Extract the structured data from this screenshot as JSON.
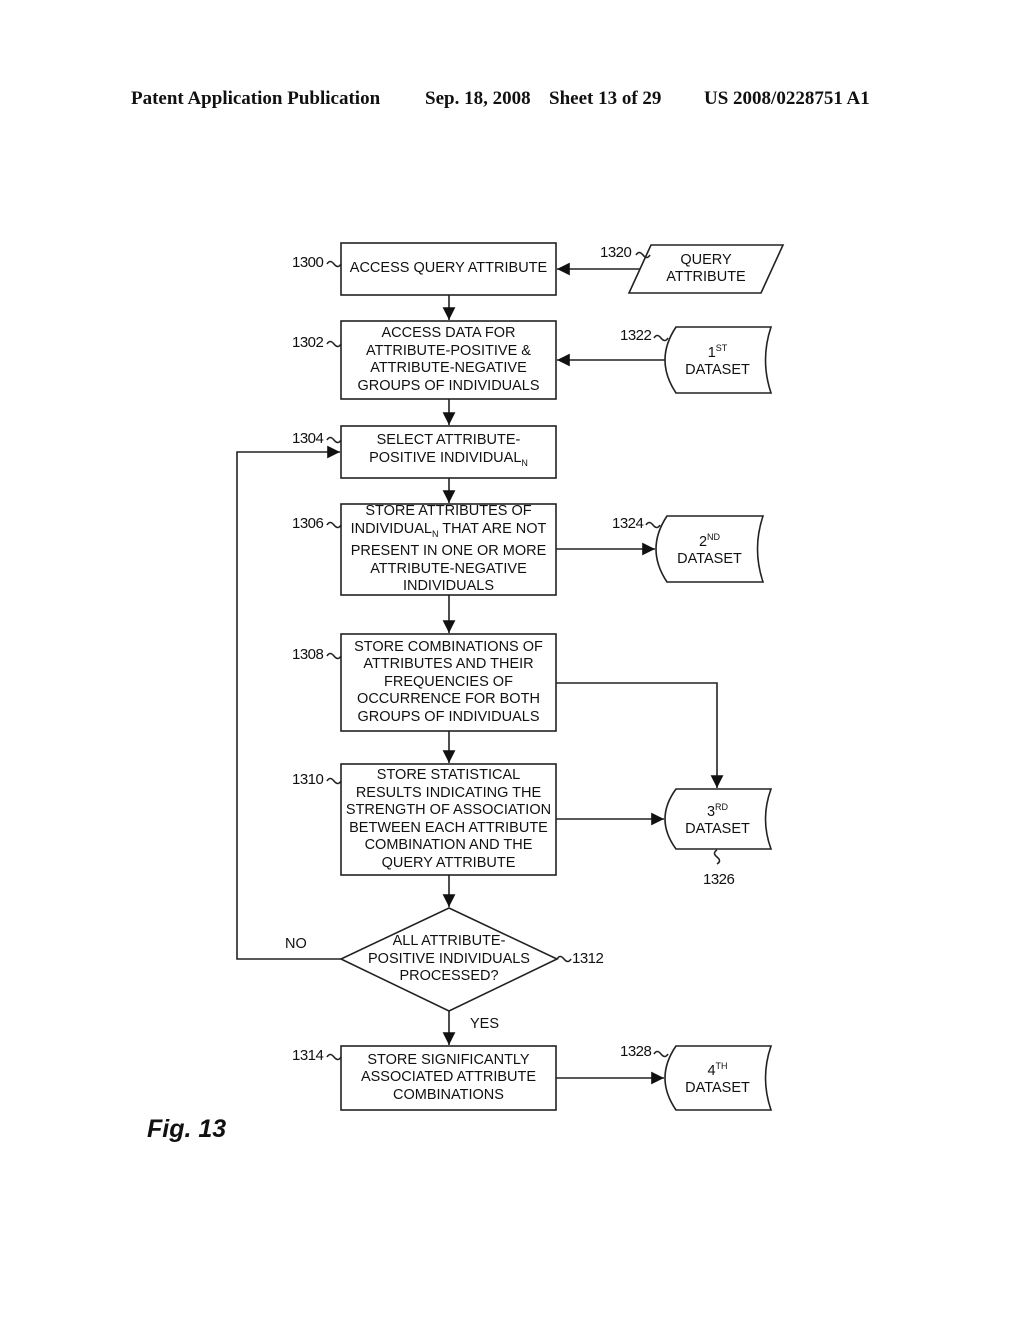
{
  "header": {
    "publication": "Patent Application Publication",
    "date": "Sep. 18, 2008",
    "sheet": "Sheet 13 of 29",
    "patent_number": "US 2008/0228751 A1"
  },
  "figure_label": "Fig. 13",
  "steps": {
    "s1300": {
      "ref": "1300",
      "text": "ACCESS QUERY ATTRIBUTE"
    },
    "s1302": {
      "ref": "1302",
      "line1": "ACCESS DATA FOR",
      "line2": "ATTRIBUTE-POSITIVE &",
      "line3": "ATTRIBUTE-NEGATIVE",
      "line4": "GROUPS OF INDIVIDUALS"
    },
    "s1304": {
      "ref": "1304",
      "line1": "SELECT ATTRIBUTE-",
      "line2": "POSITIVE INDIVIDUAL",
      "sub": "N"
    },
    "s1306": {
      "ref": "1306",
      "line1": "STORE ATTRIBUTES OF",
      "line2a": "INDIVIDUAL",
      "sub": "N",
      "line2b": " THAT ARE NOT",
      "line3": "PRESENT IN ONE OR MORE",
      "line4": "ATTRIBUTE-NEGATIVE",
      "line5": "INDIVIDUALS"
    },
    "s1308": {
      "ref": "1308",
      "line1": "STORE COMBINATIONS OF",
      "line2": "ATTRIBUTES AND THEIR",
      "line3": "FREQUENCIES OF",
      "line4": "OCCURRENCE FOR BOTH",
      "line5": "GROUPS OF INDIVIDUALS"
    },
    "s1310": {
      "ref": "1310",
      "line1": "STORE STATISTICAL",
      "line2": "RESULTS INDICATING THE",
      "line3": "STRENGTH OF ASSOCIATION",
      "line4": "BETWEEN EACH ATTRIBUTE",
      "line5": "COMBINATION AND THE",
      "line6": "QUERY ATTRIBUTE"
    },
    "s1312": {
      "ref": "1312",
      "line1": "ALL ATTRIBUTE-",
      "line2": "POSITIVE INDIVIDUALS",
      "line3": "PROCESSED?",
      "no_label": "NO",
      "yes_label": "YES"
    },
    "s1314": {
      "ref": "1314",
      "line1": "STORE SIGNIFICANTLY",
      "line2": "ASSOCIATED ATTRIBUTE",
      "line3": "COMBINATIONS"
    }
  },
  "data_nodes": {
    "d1320": {
      "ref": "1320",
      "line1": "QUERY",
      "line2": "ATTRIBUTE"
    },
    "d1322": {
      "ref": "1322",
      "num": "1",
      "sup": "ST",
      "line2": "DATASET"
    },
    "d1324": {
      "ref": "1324",
      "num": "2",
      "sup": "ND",
      "line2": "DATASET"
    },
    "d1326": {
      "ref": "1326",
      "num": "3",
      "sup": "RD",
      "line2": "DATASET"
    },
    "d1328": {
      "ref": "1328",
      "num": "4",
      "sup": "TH",
      "line2": "DATASET"
    }
  }
}
